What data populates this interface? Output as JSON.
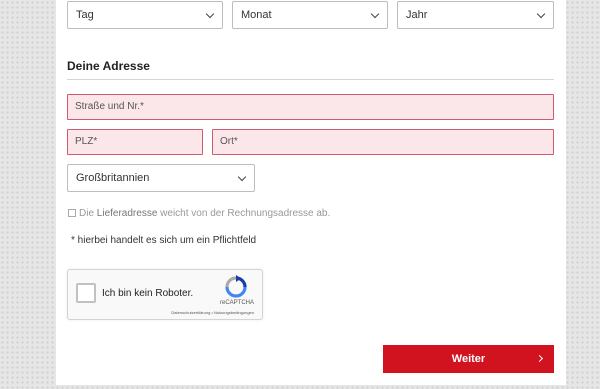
{
  "birthdate": {
    "day_placeholder": "Tag",
    "month_placeholder": "Monat",
    "year_placeholder": "Jahr"
  },
  "address": {
    "section_title": "Deine Adresse",
    "street_placeholder": "Straße und Nr.*",
    "zip_placeholder": "PLZ*",
    "city_placeholder": "Ort*",
    "country_selected": "Großbritannien"
  },
  "delivery": {
    "checkbox_prefix": "Die ",
    "checkbox_highlight": "Lieferadresse",
    "checkbox_suffix": " weicht von der Rechnungsadresse ab."
  },
  "required_hint": "* hierbei handelt es sich um ein Pflichtfeld",
  "recaptcha": {
    "label": "Ich bin kein Roboter.",
    "brand": "reCAPTCHA",
    "terms": "Datenschutzerklärung • Nutzungsbedingungen"
  },
  "submit": {
    "label": "Weiter"
  },
  "colors": {
    "accent": "#d1121f",
    "error_border": "#d05a6e",
    "error_fill": "#fbe7ea"
  }
}
